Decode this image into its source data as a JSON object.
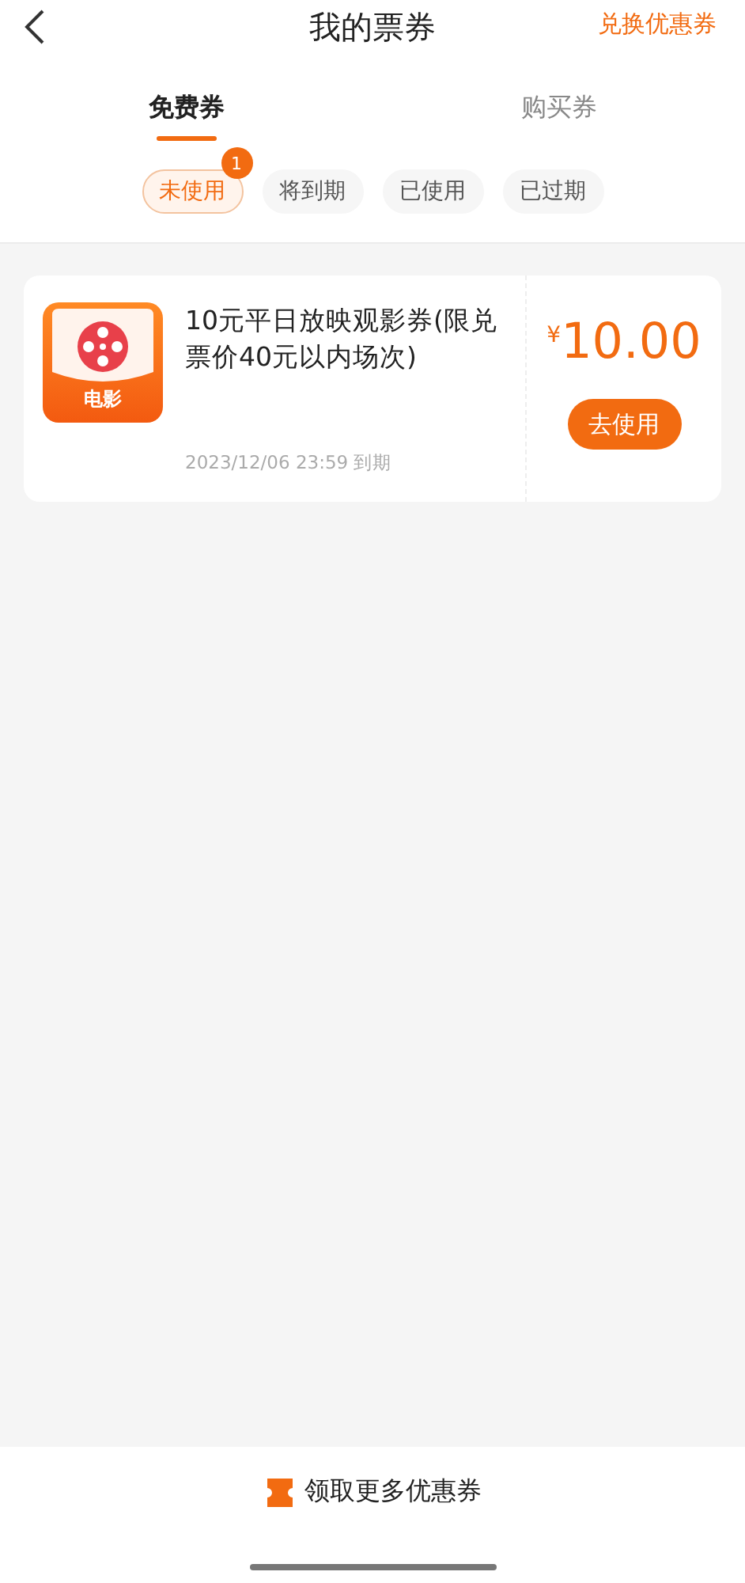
{
  "header": {
    "title": "我的票券",
    "action": "兑换优惠券"
  },
  "tabs": [
    {
      "label": "免费券",
      "selected": true
    },
    {
      "label": "购买券",
      "selected": false
    }
  ],
  "filters": [
    {
      "label": "未使用",
      "selected": true,
      "badge": "1"
    },
    {
      "label": "将到期",
      "selected": false
    },
    {
      "label": "已使用",
      "selected": false
    },
    {
      "label": "已过期",
      "selected": false
    }
  ],
  "coupons": [
    {
      "category": "电影",
      "title": "10元平日放映观影券(限兑票价40元以内场次)",
      "expiry": "2023/12/06 23:59 到期",
      "currency": "¥",
      "amount": "10.00",
      "button": "去使用"
    }
  ],
  "bottom_bar": {
    "label": "领取更多优惠券"
  }
}
